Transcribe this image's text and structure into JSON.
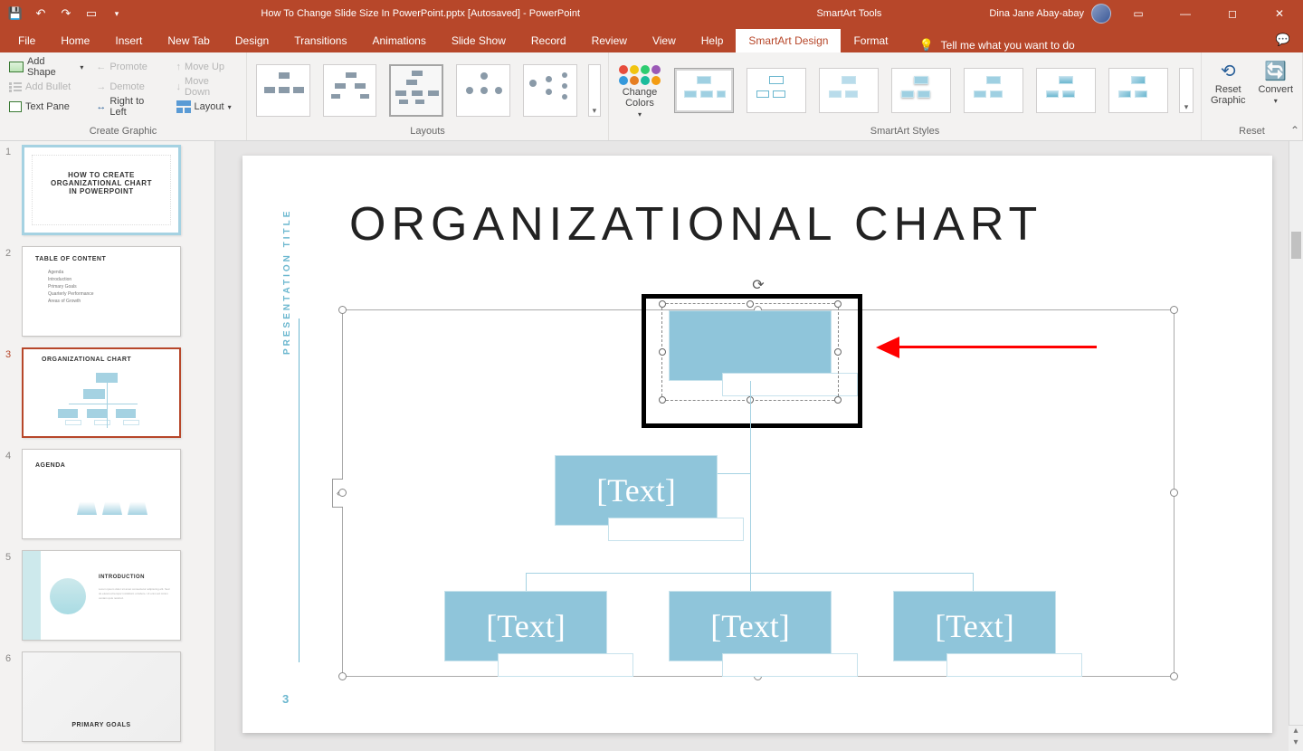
{
  "titlebar": {
    "doc_title": "How To Change Slide Size In PowerPoint.pptx [Autosaved]  -  PowerPoint",
    "tool_context": "SmartArt Tools",
    "user": "Dina Jane Abay-abay"
  },
  "tabs": {
    "file": "File",
    "home": "Home",
    "insert": "Insert",
    "newtab": "New Tab",
    "design": "Design",
    "transitions": "Transitions",
    "animations": "Animations",
    "slideshow": "Slide Show",
    "record": "Record",
    "review": "Review",
    "view": "View",
    "help": "Help",
    "sa_design": "SmartArt Design",
    "format": "Format",
    "tellme": "Tell me what you want to do"
  },
  "ribbon": {
    "create_graphic": {
      "add_shape": "Add Shape",
      "add_bullet": "Add Bullet",
      "text_pane": "Text Pane",
      "promote": "Promote",
      "demote": "Demote",
      "r2l": "Right to Left",
      "move_up": "Move Up",
      "move_down": "Move Down",
      "layout": "Layout",
      "label": "Create Graphic"
    },
    "layouts": {
      "label": "Layouts"
    },
    "change_colors": "Change Colors",
    "styles": {
      "label": "SmartArt Styles"
    },
    "reset": {
      "reset_graphic": "Reset Graphic",
      "convert": "Convert",
      "label": "Reset"
    }
  },
  "thumbs": {
    "s1": {
      "title1": "HOW TO CREATE",
      "title2": "ORGANIZATIONAL CHART",
      "title3": "IN POWERPOINT"
    },
    "s2": {
      "heading": "TABLE OF CONTENT",
      "items": [
        "Agenda",
        "Introduction",
        "Primary Goals",
        "Quarterly Performance",
        "Areas of Growth"
      ]
    },
    "s3": {
      "heading": "ORGANIZATIONAL CHART"
    },
    "s4": {
      "heading": "AGENDA"
    },
    "s5": {
      "heading": "INTRODUCTION"
    },
    "s6": {
      "heading": "PRIMARY GOALS"
    }
  },
  "slide": {
    "side_title": "PRESENTATION TITLE",
    "pagenum": "3",
    "heading": "ORGANIZATIONAL CHART",
    "placeholder": "[Text]"
  }
}
